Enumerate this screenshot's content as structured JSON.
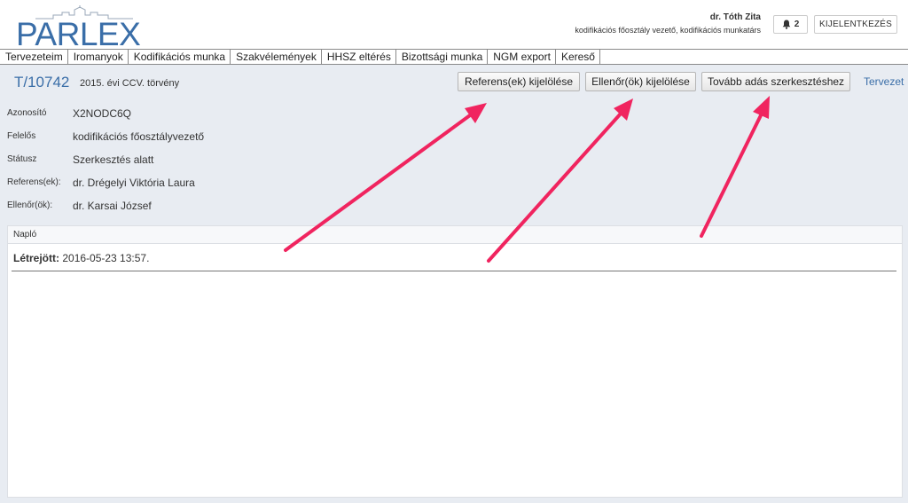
{
  "header": {
    "logo_text": "PARLEX",
    "user_name": "dr. Tóth Zita",
    "user_role": "kodifikációs főosztály vezető, kodifikációs munkatárs",
    "notification_count": "2",
    "logout_label": "KIJELENTKEZÉS"
  },
  "nav": {
    "items": [
      "Tervezeteim",
      "Iromanyok",
      "Kodifikációs munka",
      "Szakvélemények",
      "HHSZ eltérés",
      "Bizottsági munka",
      "NGM export",
      "Kereső"
    ]
  },
  "document": {
    "id": "T/10742",
    "title": "2015. évi CCV. törvény",
    "actions": {
      "assign_referens": "Referens(ek) kijelölése",
      "assign_ellenor": "Ellenőr(ök) kijelölése",
      "forward_edit": "Tovább adás szerkesztéshez"
    },
    "tervezet_link": "Tervezet",
    "fields": [
      {
        "label": "Azonosító",
        "value": "X2NODC6Q"
      },
      {
        "label": "Felelős",
        "value": "kodifikációs főosztályvezető"
      },
      {
        "label": "Státusz",
        "value": "Szerkesztés alatt"
      },
      {
        "label": "Referens(ek):",
        "value": "dr. Drégelyi Viktória Laura"
      },
      {
        "label": "Ellenőr(ök):",
        "value": "dr. Karsai József"
      }
    ]
  },
  "log": {
    "title": "Napló",
    "entry_label": "Létrejött:",
    "entry_value": "2016-05-23 13:57."
  },
  "colors": {
    "brand_blue": "#3a6ea8",
    "background": "#e8ecf2",
    "annotation_arrow": "#f0245f"
  }
}
